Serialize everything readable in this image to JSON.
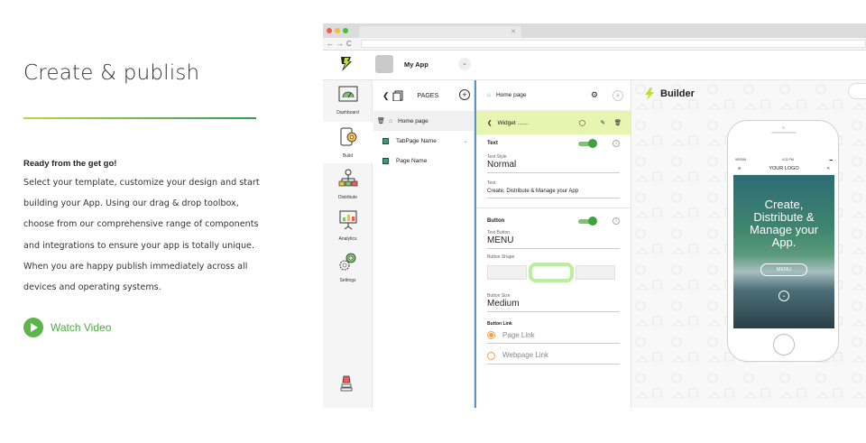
{
  "marketing": {
    "title": "Create & publish",
    "subtitle": "Ready from the get go!",
    "paragraph": "Select your template, customize your design and start building your App. Using our drag & drop toolbox, choose from our comprehensive range of components and integrations to ensure your app is totally unique. When you are happy publish immediately across all devices and operating systems.",
    "watch_label": "Watch Video"
  },
  "app": {
    "name": "My App",
    "sidebar": [
      {
        "label": "Dashboard",
        "icon": "dashboard-icon"
      },
      {
        "label": "Build",
        "icon": "build-icon"
      },
      {
        "label": "Distribute",
        "icon": "distribute-icon"
      },
      {
        "label": "Analytics",
        "icon": "analytics-icon"
      },
      {
        "label": "Settings",
        "icon": "settings-icon"
      }
    ],
    "pages_title": "PAGES",
    "pages": [
      {
        "label": "Home page"
      },
      {
        "label": "TabPage Name"
      },
      {
        "label": "Page Name"
      }
    ],
    "props": {
      "header": "Home page",
      "widget": "Widget .......",
      "text_section": "Text",
      "text_style_label": "Text Style",
      "text_style_value": "Normal",
      "text_label": "Text",
      "text_value": "Create, Distribute & Manage your App",
      "button_section": "Button",
      "text_button_label": "Text Button",
      "text_button_value": "MENU",
      "button_shape_label": "Button Shape",
      "button_size_label": "Button Size",
      "button_size_value": "Medium",
      "button_link_label": "Button Link",
      "page_link": "Page Link",
      "webpage_link": "Webpage Link"
    },
    "builder_label": "Builder",
    "phone": {
      "logo": "YOUR LOGO",
      "hero_text": "Create, Distribute & Manage your App.",
      "button": "MENU",
      "carrier": "VIRGIN",
      "time": "4:21 PM"
    }
  },
  "colors": {
    "accent_green": "#5cb44a",
    "highlight": "#e8f5b0",
    "radio": "#f0a04b"
  }
}
